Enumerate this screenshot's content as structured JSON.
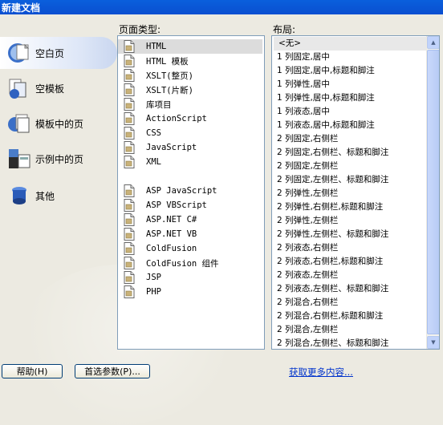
{
  "window": {
    "title": "新建文档"
  },
  "categories": [
    {
      "label": "空白页",
      "icon": "blank-page-icon",
      "selected": true
    },
    {
      "label": "空模板",
      "icon": "empty-template-icon",
      "selected": false
    },
    {
      "label": "模板中的页",
      "icon": "template-page-icon",
      "selected": false
    },
    {
      "label": "示例中的页",
      "icon": "sample-page-icon",
      "selected": false
    },
    {
      "label": "其他",
      "icon": "other-icon",
      "selected": false
    }
  ],
  "page_types": {
    "header": "页面类型:",
    "items": [
      {
        "label": "HTML",
        "selected": true
      },
      {
        "label": "HTML 模板"
      },
      {
        "label": "XSLT(整页)"
      },
      {
        "label": "XSLT(片断)"
      },
      {
        "label": "库项目"
      },
      {
        "label": "ActionScript"
      },
      {
        "label": "CSS"
      },
      {
        "label": "JavaScript"
      },
      {
        "label": "XML"
      },
      {
        "label": "ASP JavaScript"
      },
      {
        "label": "ASP VBScript"
      },
      {
        "label": "ASP.NET C#"
      },
      {
        "label": "ASP.NET VB"
      },
      {
        "label": "ColdFusion"
      },
      {
        "label": "ColdFusion 组件"
      },
      {
        "label": "JSP"
      },
      {
        "label": "PHP"
      }
    ]
  },
  "layouts": {
    "header": "布局:",
    "items": [
      "<无>",
      "1 列固定,居中",
      "1 列固定,居中,标题和脚注",
      "1 列弹性,居中",
      "1 列弹性,居中,标题和脚注",
      "1 列液态,居中",
      "1 列液态,居中,标题和脚注",
      "2 列固定,右侧栏",
      "2 列固定,右侧栏、标题和脚注",
      "2 列固定,左侧栏",
      "2 列固定,左侧栏、标题和脚注",
      "2 列弹性,左侧栏",
      "2 列弹性,右侧栏,标题和脚注",
      "2 列弹性,左侧栏",
      "2 列弹性,左侧栏、标题和脚注",
      "2 列液态,右侧栏",
      "2 列液态,右侧栏,标题和脚注",
      "2 列液态,左侧栏",
      "2 列液态,左侧栏、标题和脚注",
      "2 列混合,右侧栏",
      "2 列混合,右侧栏,标题和脚注",
      "2 列混合,左侧栏",
      "2 列混合,左侧栏、标题和脚注"
    ]
  },
  "buttons": {
    "help": "帮助(H)",
    "preferences": "首选参数(P)..."
  },
  "link": {
    "more_content": "获取更多内容..."
  }
}
